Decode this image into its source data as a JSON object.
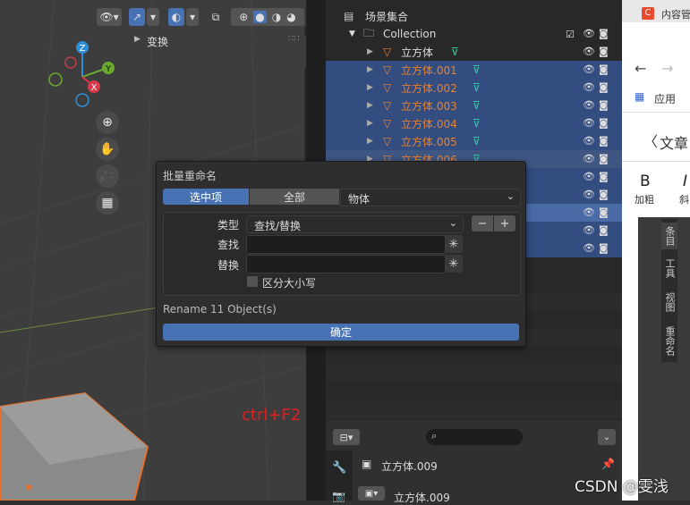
{
  "viewport": {
    "transform_label": "变换",
    "side_tabs": [
      "条目",
      "工具",
      "视图",
      "名"
    ],
    "shortcut_hint": "ctrl+F2"
  },
  "outliner": {
    "scene_collection": "场景集合",
    "collection": "Collection",
    "objects": [
      {
        "name": "立方体",
        "selected": false
      },
      {
        "name": "立方体.001",
        "selected": true
      },
      {
        "name": "立方体.002",
        "selected": true
      },
      {
        "name": "立方体.003",
        "selected": true
      },
      {
        "name": "立方体.004",
        "selected": true
      },
      {
        "name": "立方体.005",
        "selected": true
      },
      {
        "name": "立方体.006",
        "selected": true
      }
    ]
  },
  "dialog": {
    "title": "批量重命名",
    "tabs": [
      "选中项",
      "全部"
    ],
    "target_type": "物体",
    "type_label": "类型",
    "type_value": "查找/替换",
    "find_label": "查找",
    "find_value": "",
    "replace_label": "替换",
    "replace_value": "",
    "case_label": "区分大小写",
    "summary": "Rename 11 Object(s)",
    "confirm": "确定"
  },
  "properties": {
    "object_name": "立方体.009",
    "data_name": "立方体.009"
  },
  "browser": {
    "tab_title": "内容管",
    "apps_label": "应用",
    "article_label": "文章",
    "bold_glyph": "B",
    "bold_label": "加粗",
    "italic_glyph": "I",
    "italic_label": "斜",
    "side_tabs": [
      "条目",
      "工具",
      "视图",
      "重命名"
    ]
  },
  "watermark": "CSDN @雯浅",
  "colors": {
    "accent_blue": "#4772b3",
    "selected_row": "#334d80",
    "object_orange": "#e9832c",
    "hint_red": "#e02020"
  }
}
